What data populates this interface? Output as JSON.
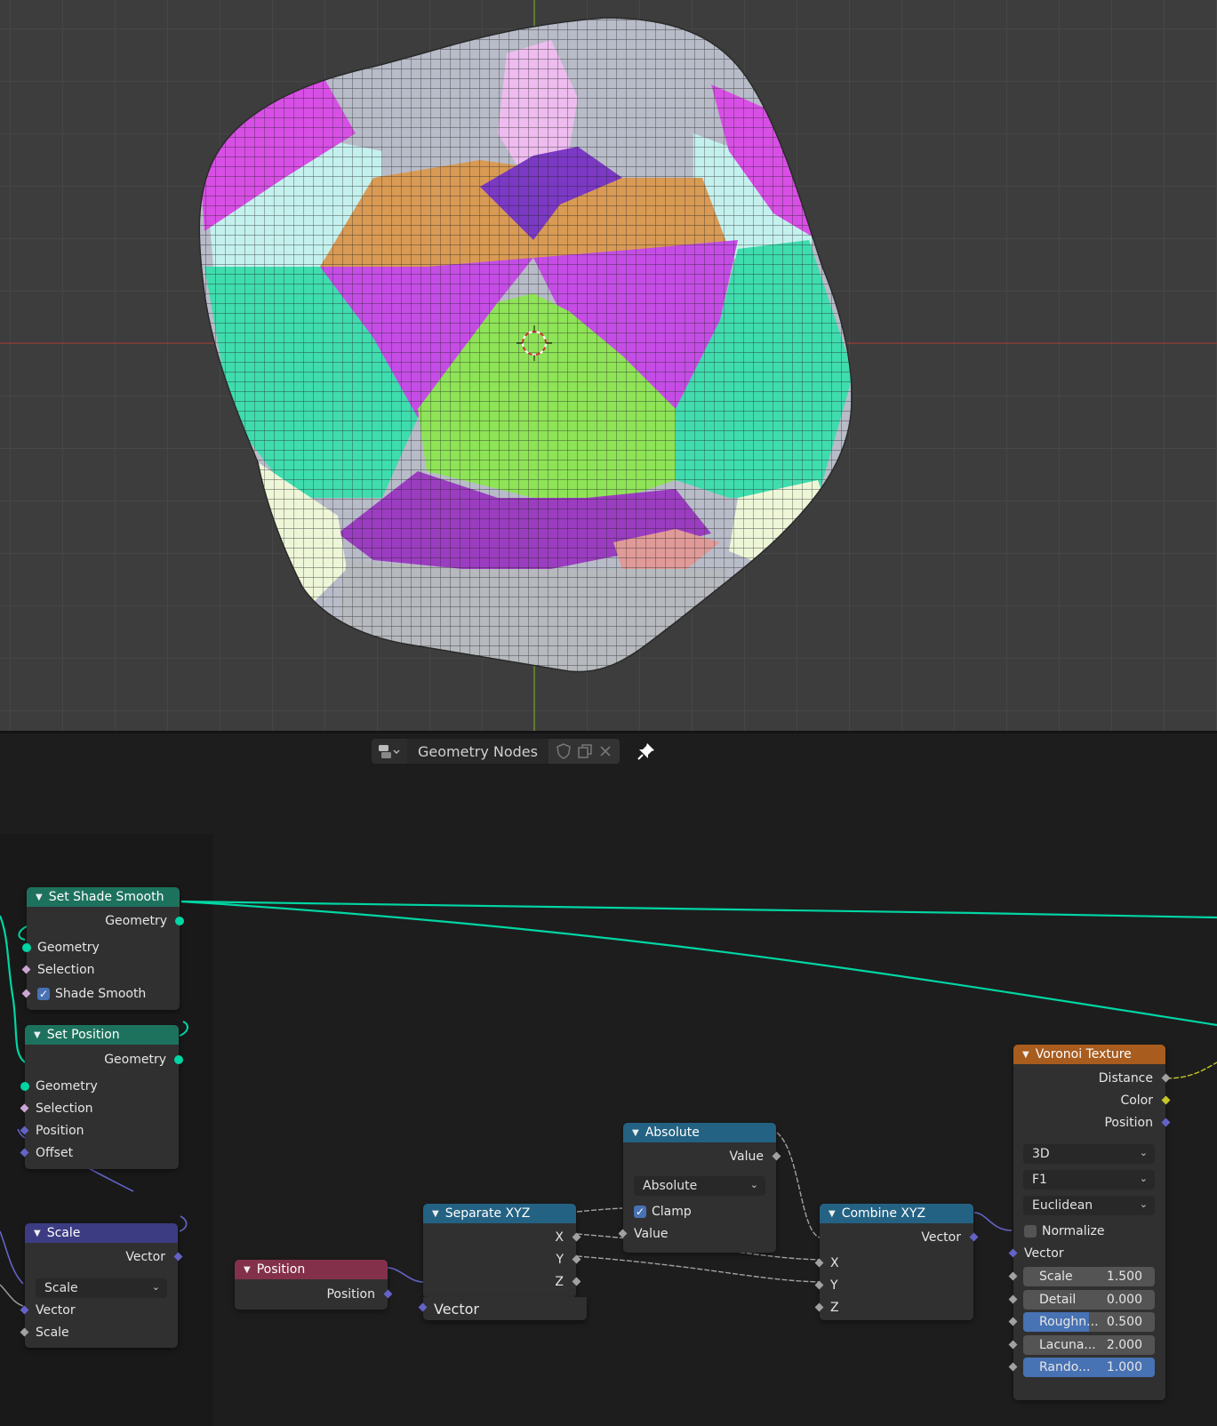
{
  "editor_header": {
    "title": "Geometry Nodes"
  },
  "nodes": {
    "set_shade_smooth": {
      "title": "Set Shade Smooth",
      "output": "Geometry",
      "inputs": [
        "Geometry",
        "Selection"
      ],
      "checkbox_label": "Shade Smooth"
    },
    "set_position": {
      "title": "Set Position",
      "output": "Geometry",
      "inputs": [
        "Geometry",
        "Selection",
        "Position",
        "Offset"
      ]
    },
    "scale": {
      "title": "Scale",
      "output": "Vector",
      "mode": "Scale",
      "inputs": [
        "Vector",
        "Scale"
      ]
    },
    "position": {
      "title": "Position",
      "output": "Position"
    },
    "separate_xyz": {
      "title": "Separate XYZ",
      "outputs": [
        "X",
        "Y",
        "Z"
      ],
      "input": "Vector"
    },
    "absolute": {
      "title": "Absolute",
      "output": "Value",
      "mode": "Absolute",
      "checkbox_label": "Clamp",
      "input": "Value"
    },
    "combine_xyz": {
      "title": "Combine XYZ",
      "output": "Vector",
      "inputs": [
        "X",
        "Y",
        "Z"
      ]
    },
    "voronoi": {
      "title": "Voronoi Texture",
      "outputs": [
        "Distance",
        "Color",
        "Position"
      ],
      "dimensions": "3D",
      "feature": "F1",
      "distance_metric": "Euclidean",
      "normalize_label": "Normalize",
      "vector_label": "Vector",
      "fields": [
        {
          "label": "Scale",
          "value": "1.500",
          "fill": 0
        },
        {
          "label": "Detail",
          "value": "0.000",
          "fill": 0
        },
        {
          "label": "Roughn...",
          "value": "0.500",
          "fill": 0.5
        },
        {
          "label": "Lacuna...",
          "value": "2.000",
          "fill": 0
        },
        {
          "label": "Rando...",
          "value": "1.000",
          "fill": 1.0
        }
      ]
    }
  },
  "colors": {
    "geometry_socket": "#00d6a3",
    "vector_socket": "#6363c7",
    "float_socket": "#a1a1a1",
    "color_socket": "#c7c729",
    "bool_socket": "#cca6d6",
    "geometry_header": "#1d725e",
    "vector_header": "#3c3c83",
    "input_header": "#83314a",
    "converter_header": "#246283",
    "texture_header": "#e66d1a"
  }
}
